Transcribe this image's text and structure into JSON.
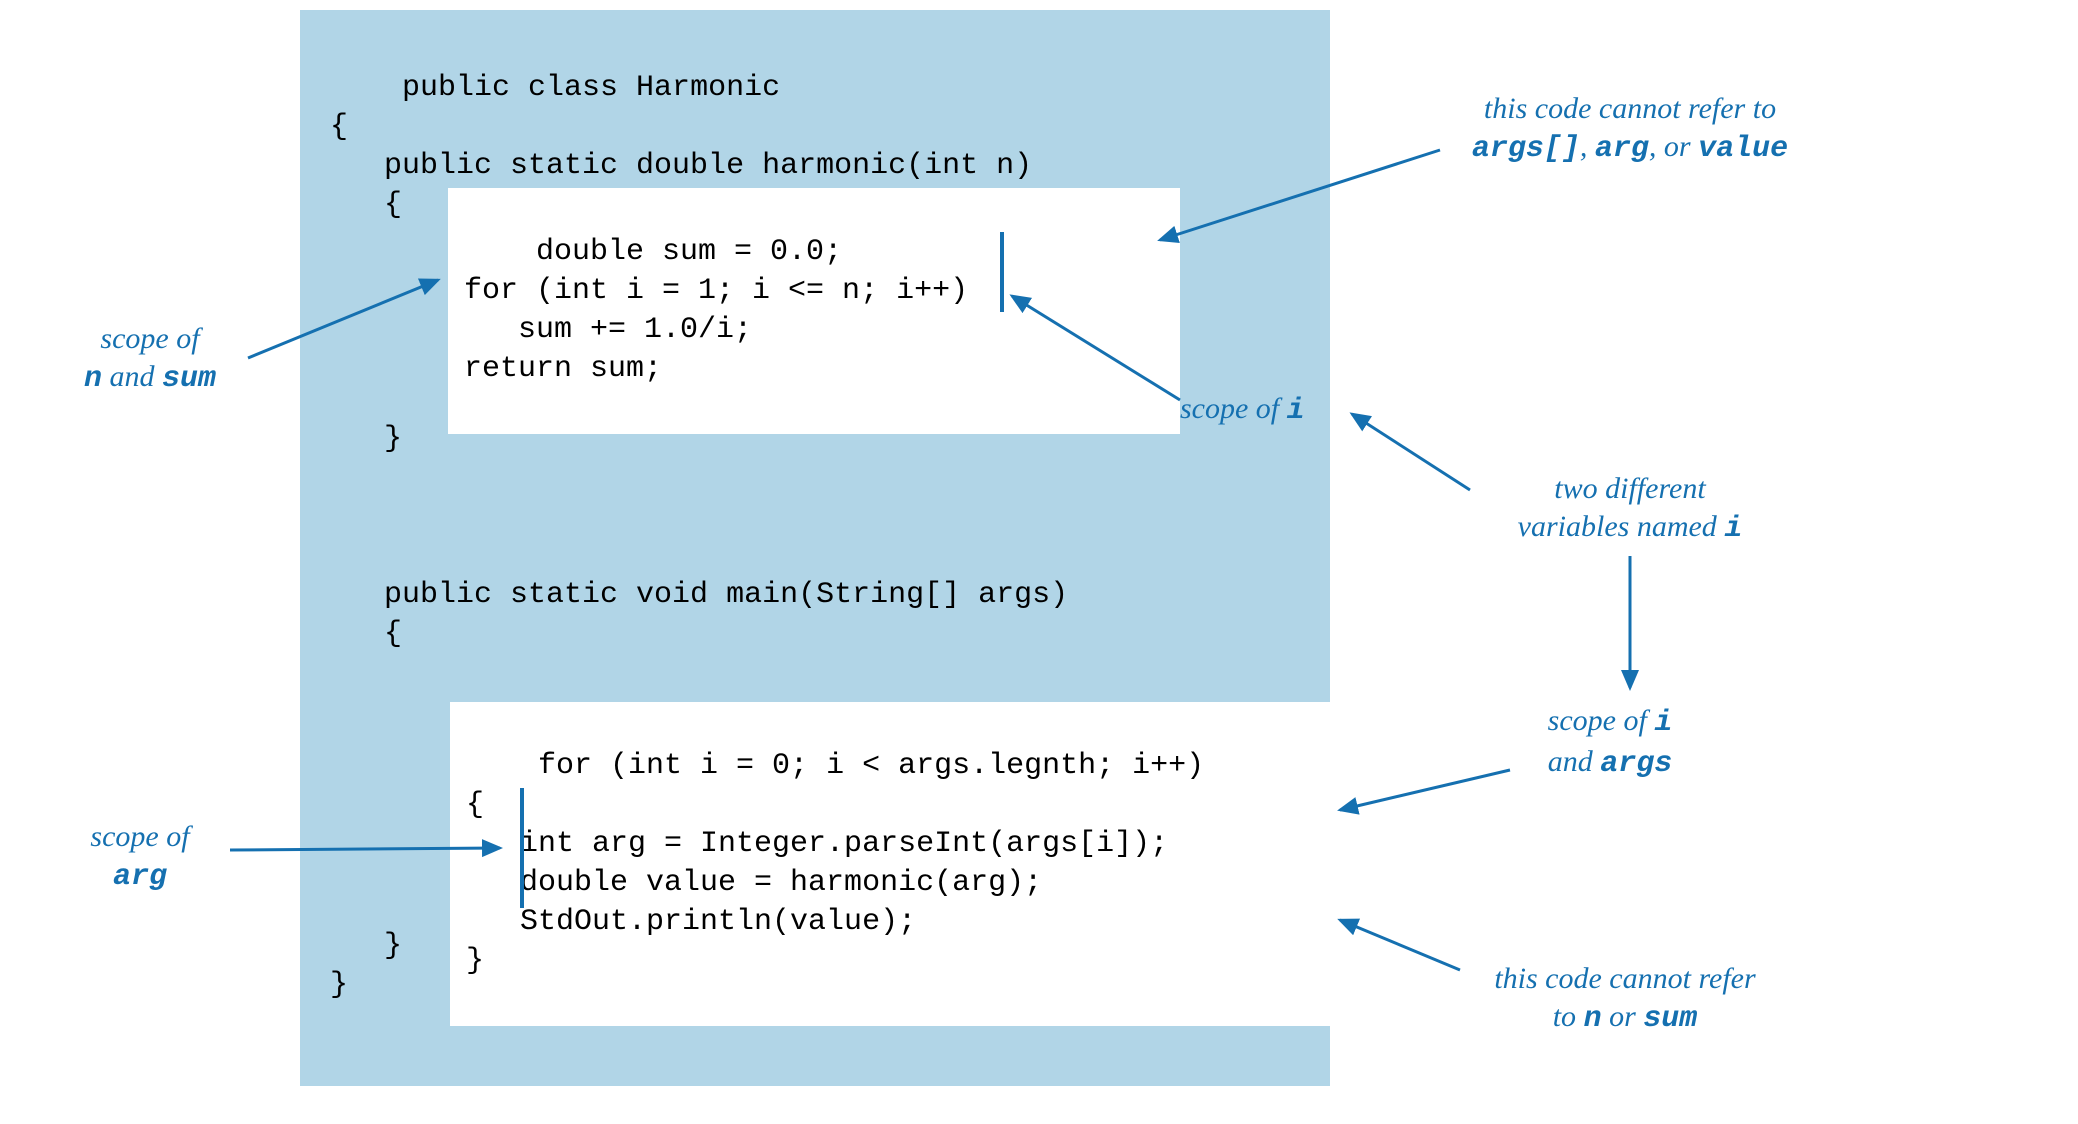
{
  "code": {
    "full": "public class Harmonic\n{\n   public static double harmonic(int n)\n   {\n\n\n\n\n\n   }\n\n\n\n   public static void main(String[] args)\n   {\n\n\n\n\n\n\n\n   }\n}",
    "box1": "double sum = 0.0;\nfor (int i = 1; i <= n; i++)\n   sum += 1.0/i;\nreturn sum;",
    "box2": "for (int i = 0; i < args.legnth; i++)\n{\n   int arg = Integer.parseInt(args[i]);\n   double value = harmonic(arg);\n   StdOut.println(value);\n}"
  },
  "annotations": {
    "scope_n_sum_1": "scope of",
    "scope_n_sum_2n": "n",
    "scope_n_sum_2mid": " and ",
    "scope_n_sum_2sum": "sum",
    "scope_arg_1": "scope of",
    "scope_arg_2": "arg",
    "cannot_refer_args_1": "this code cannot refer to",
    "cannot_refer_args_2a": "args[]",
    "cannot_refer_args_2mid1": ", ",
    "cannot_refer_args_2b": "arg",
    "cannot_refer_args_2mid2": ", or ",
    "cannot_refer_args_2c": "value",
    "scope_of_i": "scope of ",
    "scope_of_i_var": "i",
    "two_diff_1": "two different",
    "two_diff_2": "variables named ",
    "two_diff_var": "i",
    "scope_i_args_1": "scope of ",
    "scope_i_args_var": "i",
    "scope_i_args_2": "and ",
    "scope_i_args_var2": "args",
    "cannot_refer_n_sum_1": "this code cannot refer",
    "cannot_refer_n_sum_2a": "to ",
    "cannot_refer_n_sum_2n": "n",
    "cannot_refer_n_sum_2mid": " or ",
    "cannot_refer_n_sum_2sum": "sum"
  }
}
